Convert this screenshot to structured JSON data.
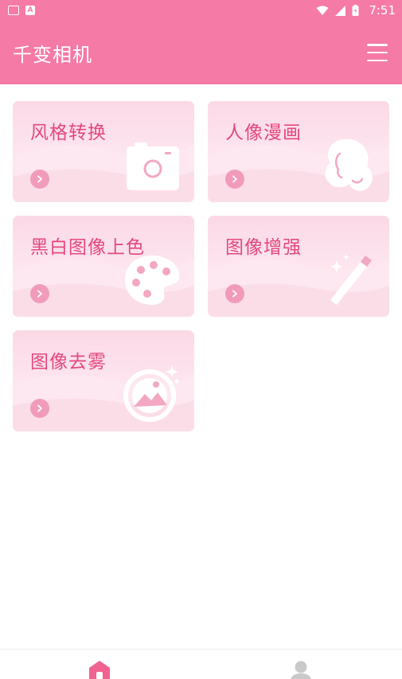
{
  "status_bar": {
    "time": "7:51"
  },
  "app_bar": {
    "title": "千变相机"
  },
  "cards": [
    {
      "label": "风格转换",
      "icon": "camera-icon"
    },
    {
      "label": "人像漫画",
      "icon": "portrait-icon"
    },
    {
      "label": "黑白图像上色",
      "icon": "palette-icon"
    },
    {
      "label": "图像增强",
      "icon": "magic-wand-icon"
    },
    {
      "label": "图像去雾",
      "icon": "image-dehaze-icon"
    }
  ],
  "bottom_nav": {
    "items": [
      {
        "icon": "home-icon",
        "active": true
      },
      {
        "icon": "profile-icon",
        "active": false
      }
    ]
  },
  "colors": {
    "accent": "#f57aa5",
    "card_title": "#e3487f",
    "nav_active": "#f0628f",
    "nav_inactive": "#c9c9c9"
  }
}
